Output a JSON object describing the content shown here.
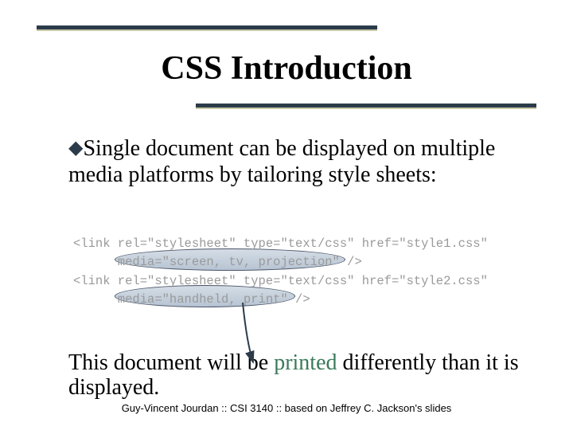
{
  "title": "CSS Introduction",
  "bullet": {
    "text": "Single document can be displayed on multiple media platforms by tailoring style sheets:"
  },
  "code": {
    "line1": "<link rel=\"stylesheet\" type=\"text/css\" href=\"style1.css\"",
    "line2": "      media=\"screen, tv, projection\" />",
    "line3": "<link rel=\"stylesheet\" type=\"text/css\" href=\"style2.css\"",
    "line4": "      media=\"handheld, print\" />"
  },
  "lower": {
    "pre": "This document will be ",
    "accent": "printed",
    "post": " differently than it is displayed."
  },
  "footer": "Guy-Vincent Jourdan :: CSI 3140 :: based on Jeffrey C. Jackson's slides"
}
